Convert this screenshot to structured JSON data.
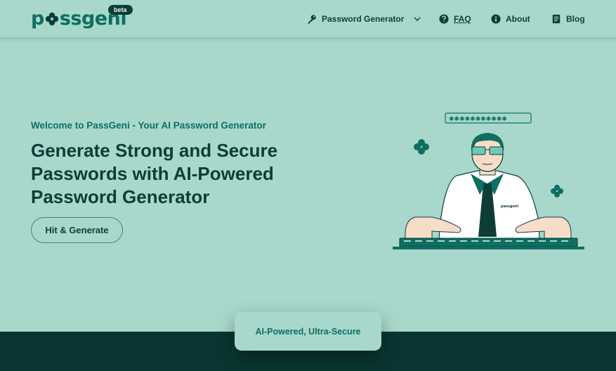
{
  "brand": {
    "logo_text_start": "p",
    "logo_text_end": "ssgeni",
    "beta_label": "beta",
    "color": "#0f6e62"
  },
  "nav": {
    "generator_label": "Password Generator",
    "faq_label": "FAQ",
    "about_label": "About",
    "blog_label": "Blog",
    "icons": [
      "key-icon",
      "chevron-down-icon",
      "question-circle-icon",
      "info-circle-icon",
      "document-icon"
    ]
  },
  "hero": {
    "welcome": "Welcome to PassGeni - Your AI Password Generator",
    "headline_line1": "Generate Strong and Secure",
    "headline_line2": "Passwords with AI-Powered",
    "headline_line3": "Password Generator",
    "cta_label": "Hit & Generate"
  },
  "illustration": {
    "shirt_logo": "passgeni",
    "password_mask": "✱✱✱✱✱✱✱✱✱✱✱"
  },
  "badge": {
    "label": "AI-Powered, Ultra-Secure"
  },
  "colors": {
    "background": "#a8d8cc",
    "accent": "#0f6e62",
    "dark": "#0d3d37",
    "footer": "#093632"
  }
}
